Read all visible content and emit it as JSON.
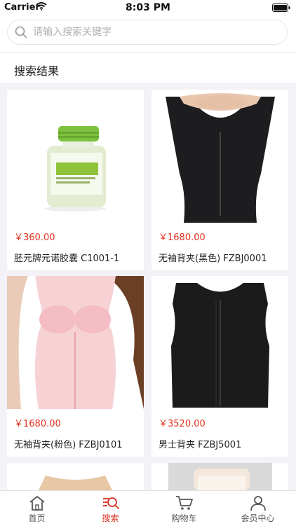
{
  "status_bar": {
    "carrier": "Carrier",
    "time": "8:03 PM"
  },
  "search": {
    "placeholder": "请输入搜索关键字",
    "value": ""
  },
  "section_title": "搜索结果",
  "products": [
    {
      "price": "￥360.00",
      "name": "胚元牌元诺胶囊  C1001-1",
      "image": "green-bottle-product"
    },
    {
      "price": "￥1680.00",
      "name": "无袖背夹(黑色)  FZBJ0001",
      "image": "black-corset-vest"
    },
    {
      "price": "￥1680.00",
      "name": "无袖背夹(粉色)  FZBJ0101",
      "image": "pink-corset-vest"
    },
    {
      "price": "￥3520.00",
      "name": "男士背夹  FZBJ5001",
      "image": "black-mens-vest"
    },
    {
      "price": "",
      "name": "",
      "image": "beige-vest"
    },
    {
      "price": "",
      "name": "",
      "image": "head-wrap"
    }
  ],
  "tabs": [
    {
      "label": "首页",
      "icon": "home-icon",
      "active": false
    },
    {
      "label": "搜索",
      "icon": "search-tab-icon",
      "active": true
    },
    {
      "label": "购物车",
      "icon": "cart-icon",
      "active": false
    },
    {
      "label": "会员中心",
      "icon": "user-icon",
      "active": false
    }
  ],
  "colors": {
    "accent": "#d8301f",
    "price": "#e0321e",
    "background": "#f2f2f7"
  }
}
